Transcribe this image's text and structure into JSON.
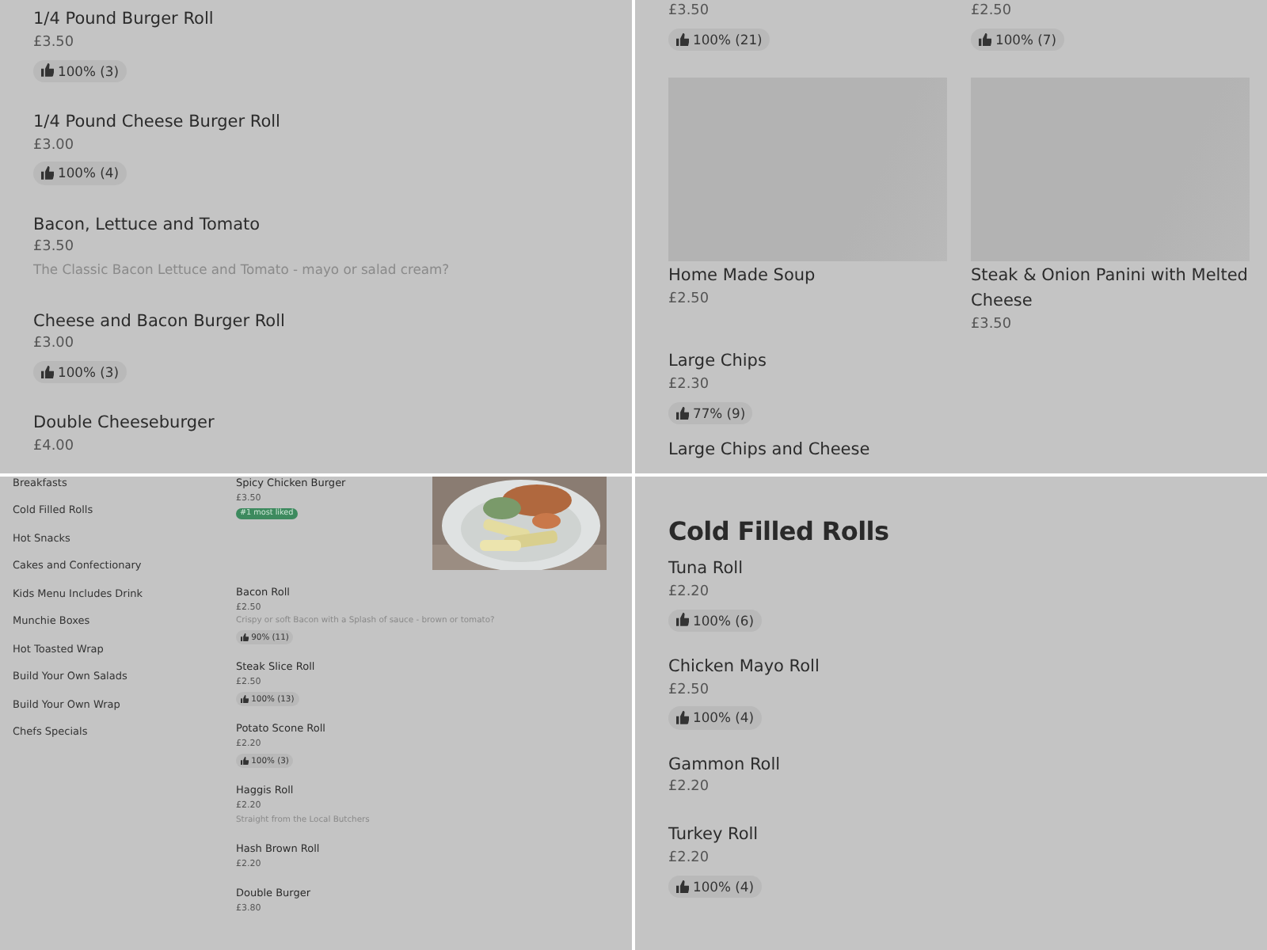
{
  "panels": [
    {
      "kind": "list",
      "items": [
        {
          "name": "1/4 Pound Burger Roll",
          "price": "£3.50",
          "rating": "100% (3)"
        },
        {
          "name": "1/4 Pound Cheese Burger Roll",
          "price": "£3.00",
          "rating": "100% (4)"
        },
        {
          "name": "Bacon, Lettuce and Tomato",
          "price": "£3.50",
          "description": "The Classic Bacon Lettuce and Tomato - mayo or salad cream?"
        },
        {
          "name": "Cheese and Bacon Burger Roll",
          "price": "£3.00",
          "rating": "100% (3)"
        },
        {
          "name": "Double Cheeseburger",
          "price": "£4.00"
        }
      ]
    },
    {
      "kind": "grid",
      "cards": [
        {
          "price": "£3.50",
          "rating": "100% (21)"
        },
        {
          "price": "£2.50",
          "rating": "100% (7)"
        },
        {
          "image": {
            "kind": "placeholder"
          },
          "name": "Home Made Soup",
          "price": "£2.50"
        },
        {
          "image": {
            "kind": "placeholder"
          },
          "name": "Steak & Onion Panini with Melted Cheese",
          "price": "£3.50"
        }
      ],
      "items": [
        {
          "name": "Large Chips",
          "price": "£2.30",
          "rating": "77% (9)"
        },
        {
          "name": "Large Chips and Cheese"
        }
      ]
    },
    {
      "kind": "store",
      "categories": [
        "Breakfasts",
        "Cold Filled Rolls",
        "Hot Snacks",
        "Cakes and Confectionary",
        "Kids Menu Includes Drink",
        "Munchie Boxes",
        "Hot Toasted Wrap",
        "Build Your Own Salads",
        "Build Your Own Wrap",
        "Chefs Specials"
      ],
      "items": [
        {
          "name": "Spicy Chicken Burger",
          "price": "£3.50",
          "badge": "#1 most liked"
        },
        {
          "name": "Bacon Roll",
          "price": "£2.50",
          "description": "Crispy or soft Bacon with a Splash of sauce - brown or tomato?",
          "rating": "90% (11)"
        },
        {
          "name": "Steak Slice Roll",
          "price": "£2.50",
          "rating": "100% (13)"
        },
        {
          "name": "Potato Scone Roll",
          "price": "£2.20",
          "rating": "100% (3)"
        },
        {
          "name": "Haggis Roll",
          "price": "£2.20",
          "description": "Straight from the Local Butchers"
        },
        {
          "name": "Hash Brown Roll",
          "price": "£2.20"
        },
        {
          "name": "Double Burger",
          "price": "£3.80"
        }
      ]
    },
    {
      "kind": "section",
      "heading": "Cold Filled Rolls",
      "items": [
        {
          "name": "Tuna Roll",
          "price": "£2.20",
          "rating": "100% (6)"
        },
        {
          "name": "Chicken Mayo Roll",
          "price": "£2.50",
          "rating": "100% (4)"
        },
        {
          "name": "Gammon Roll",
          "price": "£2.20"
        },
        {
          "name": "Turkey Roll",
          "price": "£2.20",
          "rating": "100% (4)"
        }
      ]
    }
  ]
}
